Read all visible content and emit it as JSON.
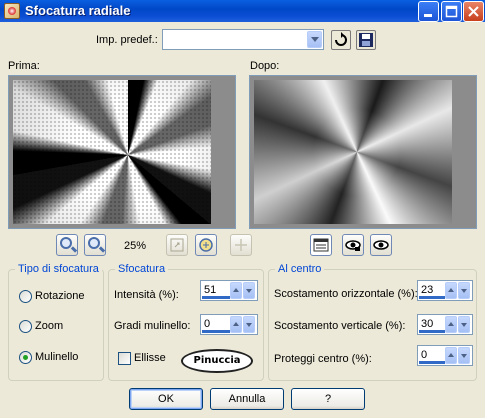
{
  "window": {
    "title": "Sfocatura radiale"
  },
  "preset": {
    "label": "Imp. predef.:",
    "value": ""
  },
  "preview": {
    "before_label": "Prima:",
    "after_label": "Dopo:",
    "zoom": "25%"
  },
  "blur_type": {
    "title": "Tipo di sfocatura",
    "options": [
      "Rotazione",
      "Zoom",
      "Mulinello"
    ],
    "selected": "Mulinello"
  },
  "blur": {
    "title": "Sfocatura",
    "intensity_label": "Intensità (%):",
    "intensity_value": "51",
    "twirl_label": "Gradi mulinello:",
    "twirl_value": "0",
    "ellipse_label": "Ellisse",
    "ellipse_checked": false
  },
  "center": {
    "title": "Al centro",
    "h_offset_label": "Scostamento orizzontale (%):",
    "h_offset_value": "23",
    "v_offset_label": "Scostamento verticale (%):",
    "v_offset_value": "30",
    "protect_label": "Proteggi centro (%):",
    "protect_value": "0"
  },
  "watermark": "Pinuccia",
  "buttons": {
    "ok": "OK",
    "cancel": "Annulla",
    "help": "?"
  },
  "colors": {
    "titlebar": "#0a4cd2",
    "group_title": "#0046d5",
    "face": "#ece9d8"
  }
}
